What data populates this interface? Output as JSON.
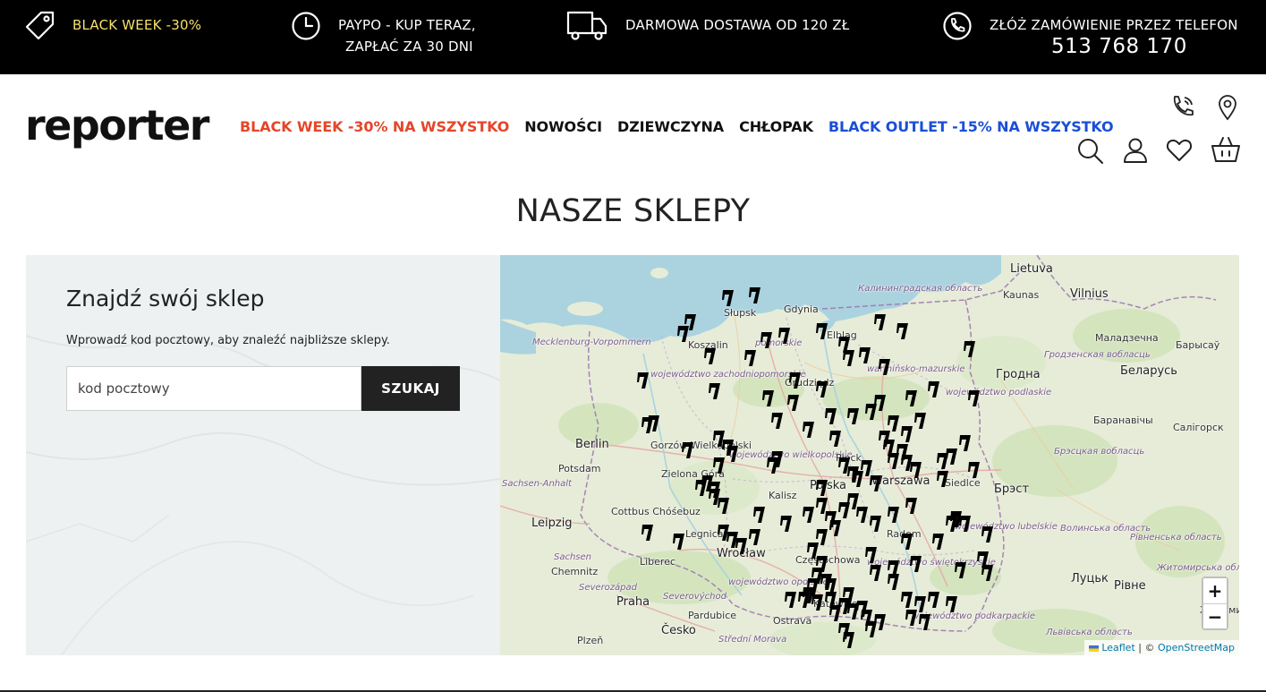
{
  "topbar": {
    "promo1": "BLACK WEEK -30%",
    "promo2_line1": "PAYPO - KUP TERAZ,",
    "promo2_line2": "ZAPŁAĆ ZA 30 DNI",
    "promo3": "DARMOWA DOSTAWA OD 120 ZŁ",
    "promo4": "ZŁÓŻ ZAMÓWIENIE PRZEZ TELEFON",
    "phone": "513 768 170",
    "icons": [
      "tag-icon",
      "clock-icon",
      "truck-icon",
      "phone-icon"
    ],
    "accent_color": "#f5e06a"
  },
  "header": {
    "logo": "reporter",
    "nav": [
      {
        "label": "BLACK WEEK -30% NA WSZYSTKO",
        "color": "#e4462a"
      },
      {
        "label": "NOWOŚCI"
      },
      {
        "label": "DZIEWCZYNA"
      },
      {
        "label": "CHŁOPAK"
      },
      {
        "label": "BLACK OUTLET -15% NA WSZYSTKO",
        "color": "#1a4fd6"
      }
    ],
    "icons": [
      "phone-call-icon",
      "location-pin-icon",
      "search-icon",
      "user-icon",
      "heart-icon",
      "basket-icon"
    ]
  },
  "page": {
    "title": "NASZE SKLEPY"
  },
  "finder": {
    "heading": "Znajdź swój sklep",
    "description": "Wprowadź kod pocztowy, aby znaleźć najbliższe sklepy.",
    "input_placeholder": "kod pocztowy",
    "button_label": "SZUKAJ"
  },
  "map": {
    "zoom_in": "+",
    "zoom_out": "−",
    "attribution_leaflet": "Leaflet",
    "attribution_sep": " | © ",
    "attribution_osm": "OpenStreetMap",
    "labels": {
      "lietuva": "Lietuva",
      "kaunas": "Kaunas",
      "vilnius": "Vilnius",
      "kaliningrad": "Калининградская область",
      "gdynia": "Gdynia",
      "slupsk": "Słupsk",
      "koszalin": "Koszalin",
      "elblag": "Elbląg",
      "mecklenburg": "Mecklenburg-Vorpommern",
      "zachodniopomorskie": "województwo zachodniopomorskie",
      "pomorskie": "pomorskie",
      "warminsko": "warmińsko-mazurskie",
      "grodno": "Гродна",
      "grodno_obl": "Гродзенская вобласць",
      "belarus": "Беларусь",
      "molodechno": "Маладзечна",
      "borisov": "Барысаў",
      "baranovichi": "Баранавічы",
      "soligorsk": "Салігорск",
      "grudziadz": "Grudziądz",
      "podlaskie": "województwo podlaskie",
      "berlin": "Berlin",
      "potsdam": "Potsdam",
      "gorzow": "Gorzów Wielkopolski",
      "zielona": "Zielona Góra",
      "wielkopolskie": "województwo wielkopolskie",
      "plock": "Płock",
      "polska": "Polska",
      "warszawa": "Warszawa",
      "siedlce": "Siedlce",
      "brest": "Брэст",
      "brest_obl": "Брэсцкая вобласць",
      "sachsen_anhalt": "Sachsen-Anhalt",
      "kalisz": "Kalisz",
      "leipzig": "Leipzig",
      "cottbus": "Cottbus Chóśebuz",
      "legnica": "Legnica",
      "radom": "Radom",
      "lubelskie": "województwo lubelskie",
      "volyn": "Волинська область",
      "rivne_obl": "Рівненська область",
      "sachsen": "Sachsen",
      "liberec": "Liberec",
      "wroclaw": "Wrocław",
      "czestochowa": "Częstochowa",
      "swietokrzyskie": "województwo świętokrzyskie",
      "lutsk": "Луцьк",
      "rivne": "Рівне",
      "chemnitz": "Chemnitz",
      "severozapad": "Severozápad",
      "opolskie": "województwo opolskie",
      "zhytomyr": "Житомирська область",
      "praha": "Praha",
      "severovychod": "Severovýchod",
      "katowice": "Katowice",
      "zhytomyr_city": "Житомир",
      "pardubice": "Pardubice",
      "ostrava": "Ostrava",
      "podkarpackie": "województwo podkarpackie",
      "lviv_obl": "Львівська область",
      "plzen": "Plzeň",
      "cesko": "Česko",
      "stredni_morava": "Střední Morava"
    }
  }
}
